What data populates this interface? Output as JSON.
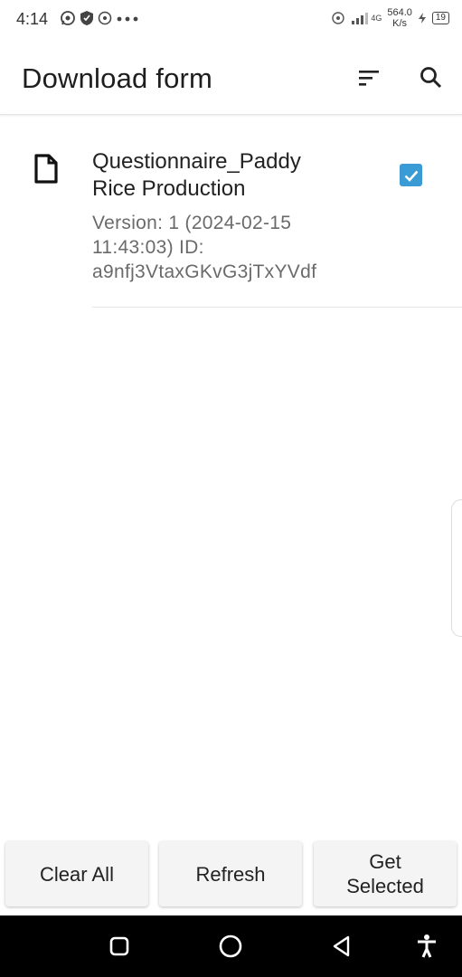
{
  "status_bar": {
    "time": "4:14",
    "speed_value": "564.0",
    "speed_unit": "K/s",
    "network": "4G",
    "battery": "19"
  },
  "app_bar": {
    "title": "Download form",
    "sort_icon": "sort-icon",
    "search_icon": "search-icon"
  },
  "forms": [
    {
      "title_line1": "Questionnaire_Paddy",
      "title_line2": "Rice Production",
      "meta_line1": "Version: 1 (2024-02-15",
      "meta_line2": "11:43:03) ID:",
      "meta_line3": "a9nfj3VtaxGKvG3jTxYVdf",
      "checked": true
    }
  ],
  "actions": {
    "clear_all": "Clear All",
    "refresh": "Refresh",
    "get_selected_line1": "Get",
    "get_selected_line2": "Selected"
  },
  "colors": {
    "accent": "#3b9bd4",
    "nav_bar": "#000000"
  }
}
